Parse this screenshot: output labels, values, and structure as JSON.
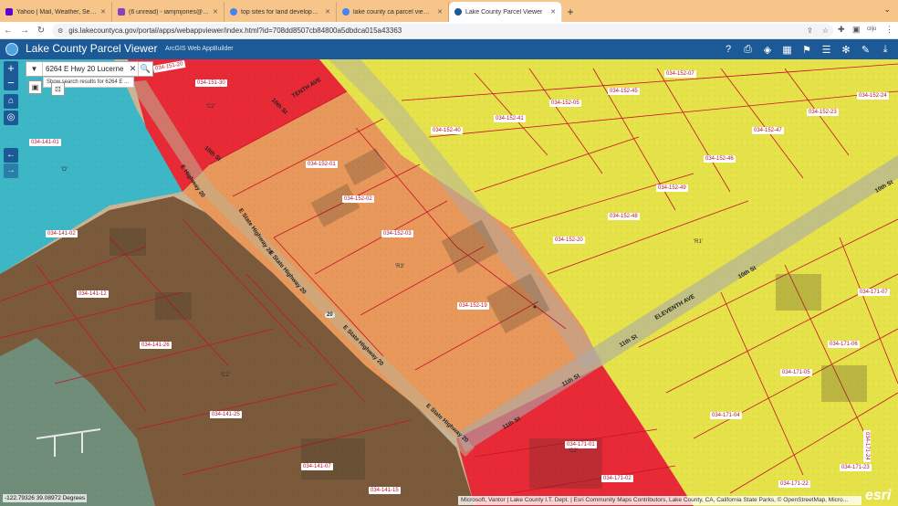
{
  "browser": {
    "tabs": [
      {
        "label": "Yahoo | Mail, Weather, Search, P",
        "color": "#6001d2",
        "active": false
      },
      {
        "label": "(6 unread) - iamjmjones@yaho",
        "color": "#8c3fbf",
        "active": false
      },
      {
        "label": "top sites for land developers fro",
        "color": "#4285f4",
        "active": false
      },
      {
        "label": "lake county ca parcel viewer - G",
        "color": "#4285f4",
        "active": false
      },
      {
        "label": "Lake County Parcel Viewer",
        "color": "#1b5a96",
        "active": true
      }
    ],
    "url": "gis.lakecountyca.gov/portal/apps/webappviewer/index.html?id=708dd8507cb84800a5dbdca015a43363",
    "profile_initials": "ciljo"
  },
  "app": {
    "title": "Lake County Parcel Viewer",
    "subtitle": "ArcGIS Web AppBuilder",
    "header_tools": [
      "help-icon",
      "print-icon",
      "layers-icon",
      "basemap-gallery-icon",
      "identify-icon",
      "query-icon",
      "measure-icon",
      "draw-icon",
      "export-icon"
    ]
  },
  "search": {
    "value": "6264 E Hwy 20 Lucerne",
    "hint": "Show search results for 6264 E ..."
  },
  "colors": {
    "teal": "#3db7c6",
    "brown": "#7a5a3a",
    "red": "#e82a36",
    "orange": "#e8985a",
    "yellow": "#e5e24a",
    "header": "#1b5a96"
  },
  "parcels": [
    {
      "label": "034-151-30"
    },
    {
      "label": "034-141-01"
    },
    {
      "label": "034-152-01"
    },
    {
      "label": "034-152-02"
    },
    {
      "label": "034-152-03"
    },
    {
      "label": "034-152-19"
    },
    {
      "label": "034-141-02"
    },
    {
      "label": "034-141-12"
    },
    {
      "label": "034-141-26"
    },
    {
      "label": "034-141-25"
    },
    {
      "label": "034-141-07"
    },
    {
      "label": "034-141-15"
    },
    {
      "label": "034-152-07"
    },
    {
      "label": "034-152-45"
    },
    {
      "label": "034-152-05"
    },
    {
      "label": "034-152-41"
    },
    {
      "label": "034-152-40"
    },
    {
      "label": "034-152-24"
    },
    {
      "label": "034-152-23"
    },
    {
      "label": "034-152-47"
    },
    {
      "label": "034-152-46"
    },
    {
      "label": "034-152-49"
    },
    {
      "label": "034-152-48"
    },
    {
      "label": "034-152-20"
    },
    {
      "label": "034-171-07"
    },
    {
      "label": "034-171-06"
    },
    {
      "label": "034-171-05"
    },
    {
      "label": "034-171-04"
    },
    {
      "label": "034-171-01"
    },
    {
      "label": "034-171-02"
    },
    {
      "label": "034-171-22"
    },
    {
      "label": "034-171-23"
    },
    {
      "label": "034-171-24"
    },
    {
      "label": "034-151-20"
    }
  ],
  "zones": [
    {
      "label": "'C2'"
    },
    {
      "label": "'O'"
    },
    {
      "label": "'R3'"
    },
    {
      "label": "'R1'"
    },
    {
      "label": "'C2'"
    },
    {
      "label": "'C2'"
    }
  ],
  "streets": [
    {
      "label": "E Highway 20"
    },
    {
      "label": "E State Highway 20"
    },
    {
      "label": "E State Highway 20"
    },
    {
      "label": "E State Highway 20"
    },
    {
      "label": "E State Highway 20"
    },
    {
      "label": "10th St"
    },
    {
      "label": "10th St"
    },
    {
      "label": "11th St"
    },
    {
      "label": "11th St"
    },
    {
      "label": "11th St"
    },
    {
      "label": "ELEVENTH AVE"
    },
    {
      "label": "TENTH AVE"
    },
    {
      "label": "10th St"
    },
    {
      "label": "10th St"
    },
    {
      "label": "20"
    }
  ],
  "status": {
    "coordinates": "-122.79326 39.08972 Degrees",
    "attribution": "Microsoft, Vantor | Lake County I.T. Dept. | Esri Community Maps Contributors, Lake County, CA, California State Parks, © OpenStreetMap, Micro...",
    "esri_logo": "esri"
  }
}
